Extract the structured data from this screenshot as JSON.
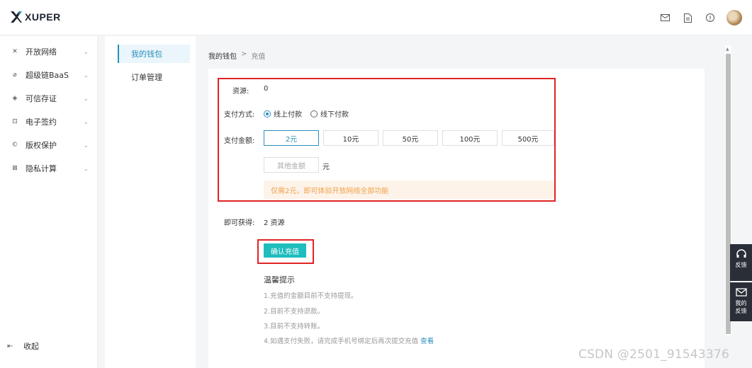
{
  "app": {
    "brand": "XUPER"
  },
  "header": {
    "icons": [
      "mail-icon",
      "document-icon",
      "info-icon"
    ],
    "avatar": "avatar"
  },
  "sidebar": {
    "items": [
      {
        "icon": "network-icon",
        "glyph": "✕",
        "label": "开放网络"
      },
      {
        "icon": "chain-icon",
        "glyph": "⌀",
        "label": "超级链BaaS"
      },
      {
        "icon": "shield-icon",
        "glyph": "◈",
        "label": "可信存证"
      },
      {
        "icon": "sign-icon",
        "glyph": "⊡",
        "label": "电子签约"
      },
      {
        "icon": "copyright-icon",
        "glyph": "©",
        "label": "版权保护"
      },
      {
        "icon": "lock-icon",
        "glyph": "⊠",
        "label": "隐私计算"
      }
    ],
    "collapse_label": "收起"
  },
  "subnav": {
    "items": [
      {
        "label": "我的钱包",
        "active": true
      },
      {
        "label": "订单管理",
        "active": false
      }
    ]
  },
  "breadcrumb": {
    "parent": "我的钱包",
    "separator": ">",
    "current": "充值"
  },
  "form": {
    "resource_label": "资源:",
    "resource_value": "0",
    "payment_method_label": "支付方式:",
    "payment_methods": [
      {
        "label": "线上付款",
        "selected": true
      },
      {
        "label": "线下付款",
        "selected": false
      }
    ],
    "amount_label": "支付金额:",
    "amounts": [
      {
        "label": "2元",
        "selected": true
      },
      {
        "label": "10元"
      },
      {
        "label": "50元"
      },
      {
        "label": "100元"
      },
      {
        "label": "500元"
      }
    ],
    "other_amount_placeholder": "其他金额",
    "unit": "元",
    "tip": "仅需2元，即可体验开放网络全部功能",
    "obtain_label": "即可获得:",
    "obtain_value": "2 资源",
    "confirm_label": "确认充值"
  },
  "notes": {
    "title": "温馨提示",
    "items": [
      "1.充值的金额目前不支持提现。",
      "2.目前不支持退款。",
      "3.目前不支持转账。"
    ],
    "last_prefix": "4.如遇支付失败，请完成手机号绑定后再次提交充值",
    "last_link": "查看"
  },
  "side_float": [
    {
      "icon": "headset-icon",
      "label": "反馈"
    },
    {
      "icon": "mail-icon",
      "label_line1": "我的",
      "label_line2": "反馈"
    }
  ],
  "watermark": "CSDN @2501_91543376",
  "colors": {
    "accent": "#2a8fbd",
    "button": "#1fbdbd",
    "highlight_box": "#e02424",
    "tip_bg": "#fdf3e9",
    "tip_text": "#f0a24a"
  }
}
